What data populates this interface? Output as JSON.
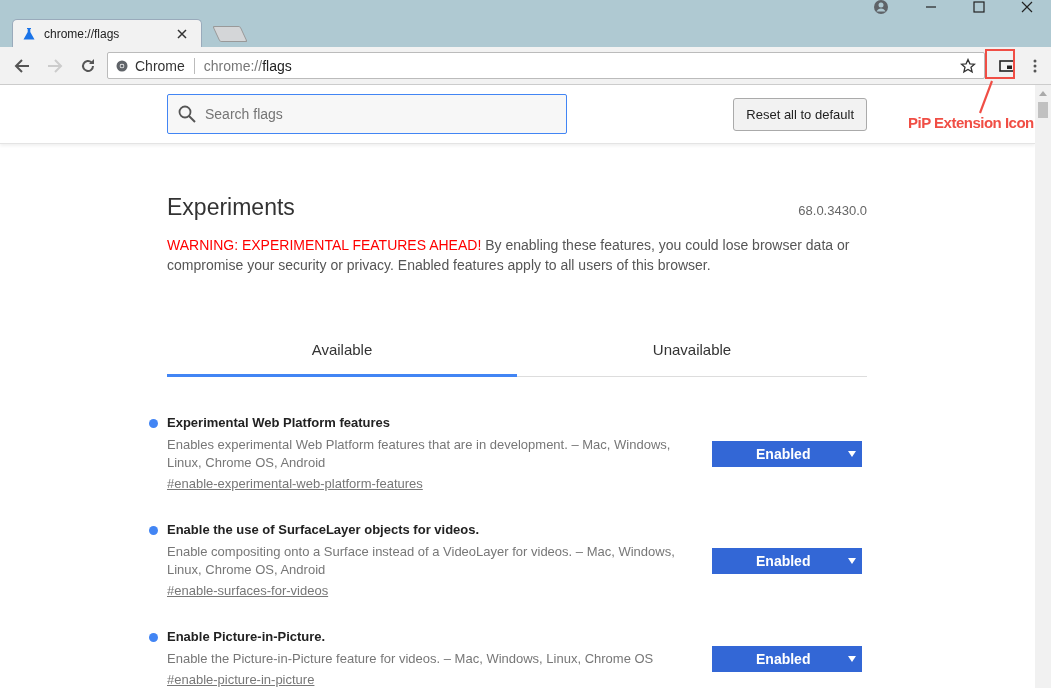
{
  "browser": {
    "tabs": [
      {
        "title": "chrome://flags",
        "selected": true
      }
    ],
    "address": {
      "site_label": "Chrome",
      "url_prefix": "chrome://",
      "url_host": "flags"
    }
  },
  "annotation": {
    "label": "PiP Extension Icon"
  },
  "header": {
    "search": {
      "placeholder": "Search flags"
    },
    "reset_button": "Reset all to default"
  },
  "page": {
    "title": "Experiments",
    "version": "68.0.3430.0",
    "warning_label": "WARNING: EXPERIMENTAL FEATURES AHEAD!",
    "warning_text": "By enabling these features, you could lose browser data or compromise your security or privacy. Enabled features apply to all users of this browser."
  },
  "tabs": [
    {
      "label": "Available",
      "selected": true
    },
    {
      "label": "Unavailable",
      "selected": false
    }
  ],
  "flags": [
    {
      "name": "Experimental Web Platform features",
      "description": "Enables experimental Web Platform features that are in development. – Mac, Windows, Linux, Chrome OS, Android",
      "link": "#enable-experimental-web-platform-features",
      "value": "Enabled",
      "modified": true
    },
    {
      "name": "Enable the use of SurfaceLayer objects for videos.",
      "description": "Enable compositing onto a Surface instead of a VideoLayer for videos. – Mac, Windows, Linux, Chrome OS, Android",
      "link": "#enable-surfaces-for-videos",
      "value": "Enabled",
      "modified": true
    },
    {
      "name": "Enable Picture-in-Picture.",
      "description": "Enable the Picture-in-Picture feature for videos. – Mac, Windows, Linux, Chrome OS",
      "link": "#enable-picture-in-picture",
      "value": "Enabled",
      "modified": true
    }
  ]
}
